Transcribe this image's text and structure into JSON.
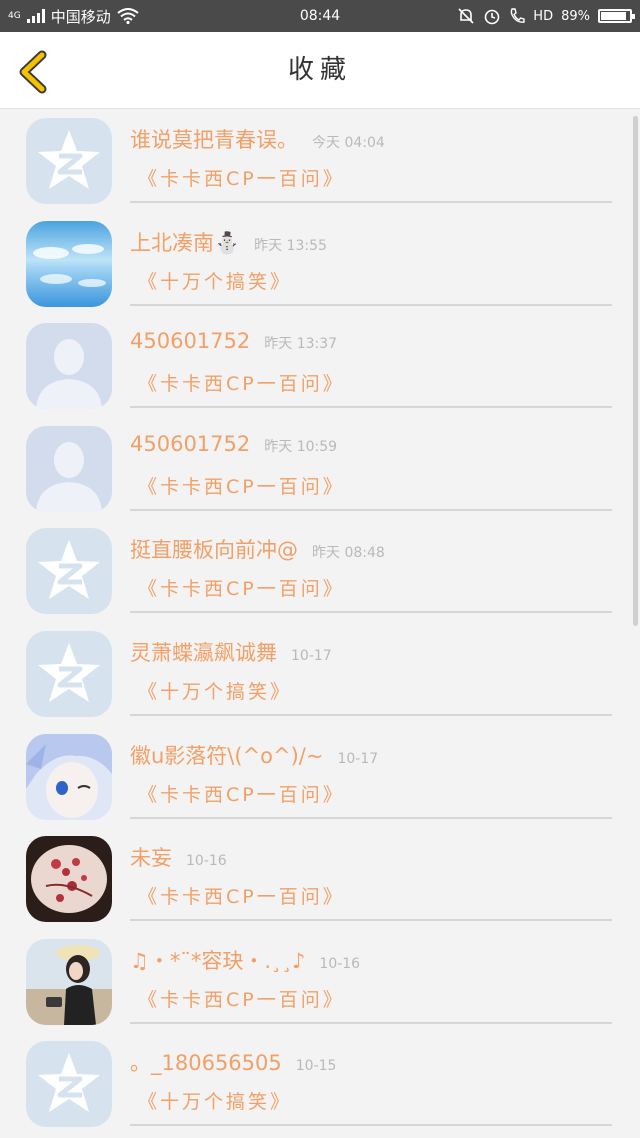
{
  "status_bar": {
    "network": "4G",
    "carrier": "中国移动",
    "time": "08:44",
    "hd": "HD",
    "battery": "89%",
    "battery_level": 0.89
  },
  "header": {
    "title": "收藏"
  },
  "colors": {
    "accent": "#f2a067",
    "back_arrow": "#f6c200",
    "avatar_bg": "#d6e3ef"
  },
  "items": [
    {
      "name": "谁说莫把青春误。",
      "time": "今天 04:04",
      "source": "《卡卡西CP一百问》",
      "avatar": "qzone-star-icon"
    },
    {
      "name": "上北凑南⛄",
      "time": "昨天 13:55",
      "source": "《十万个搞笑》",
      "avatar": "sky-photo"
    },
    {
      "name": "450601752",
      "time": "昨天 13:37",
      "source": "《卡卡西CP一百问》",
      "avatar": "default-person-icon"
    },
    {
      "name": "450601752",
      "time": "昨天 10:59",
      "source": "《卡卡西CP一百问》",
      "avatar": "default-person-icon"
    },
    {
      "name": "挺直腰板向前冲@",
      "time": "昨天 08:48",
      "source": "《卡卡西CP一百问》",
      "avatar": "qzone-star-icon"
    },
    {
      "name": "灵萧蝶瀛飙诚舞",
      "time": "10-17",
      "source": "《十万个搞笑》",
      "avatar": "qzone-star-icon"
    },
    {
      "name": "徽u影落符\\(^o^)/~",
      "time": "10-17",
      "source": "《卡卡西CP一百问》",
      "avatar": "anime-boy-photo"
    },
    {
      "name": "未妄",
      "time": "10-16",
      "source": "《卡卡西CP一百问》",
      "avatar": "flower-photo"
    },
    {
      "name": "♫・*¨*容玦・.¸¸♪",
      "time": "10-16",
      "source": "《卡卡西CP一百问》",
      "avatar": "girl-photo"
    },
    {
      "name": "。_180656505",
      "time": "10-15",
      "source": "《十万个搞笑》",
      "avatar": "qzone-star-icon"
    }
  ]
}
